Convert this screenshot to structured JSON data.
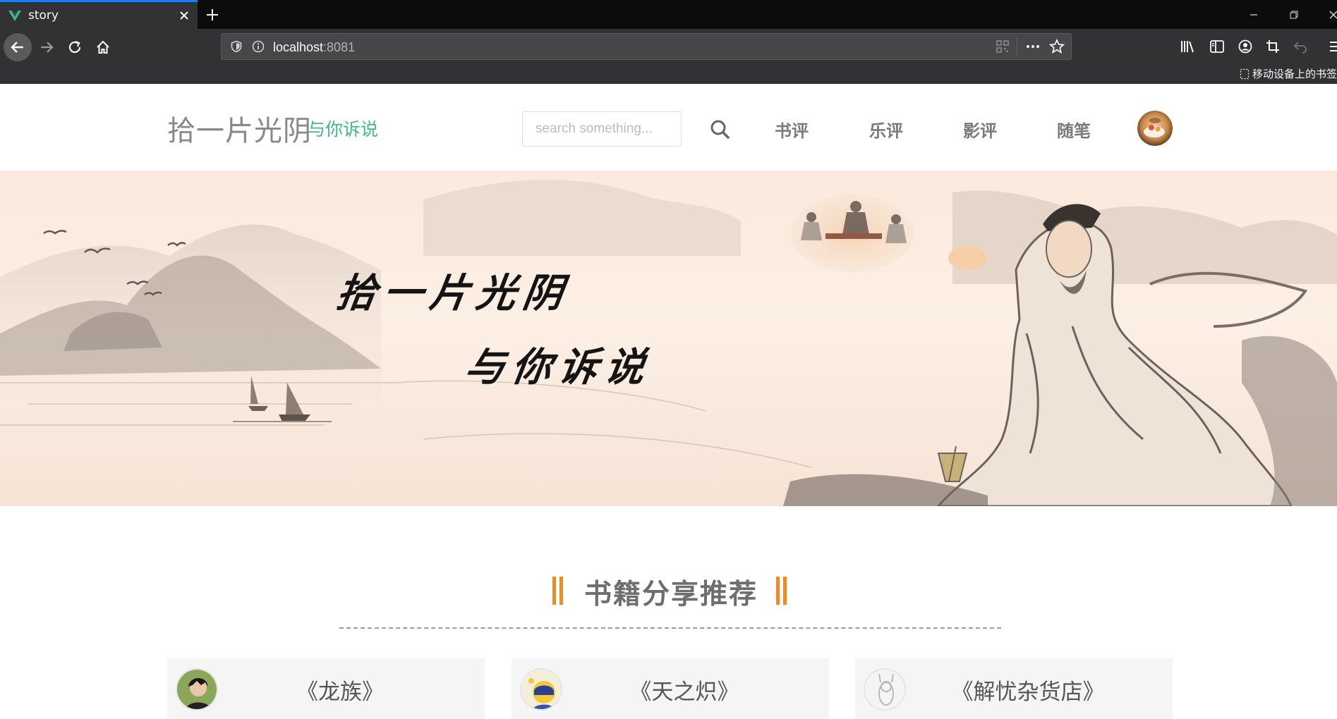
{
  "browser": {
    "tab_title": "story",
    "url_host": "localhost",
    "url_port": ":8081",
    "bookmark_hint": "移动设备上的书签"
  },
  "header": {
    "logo_main": "拾一片光阴",
    "logo_sub": "与你诉说",
    "search_placeholder": "search something...",
    "menu": [
      "书评",
      "乐评",
      "影评",
      "随笔"
    ]
  },
  "banner": {
    "line1": "拾一片光阴",
    "line2": "与你诉说"
  },
  "section": {
    "title": "书籍分享推荐",
    "cards": [
      {
        "title": "《龙族》"
      },
      {
        "title": "《天之炽》"
      },
      {
        "title": "《解忧杂货店》"
      }
    ]
  },
  "colors": {
    "accent_green": "#3fb98b",
    "accent_orange": "#f08a24",
    "tab_highlight": "#0a84ff"
  }
}
